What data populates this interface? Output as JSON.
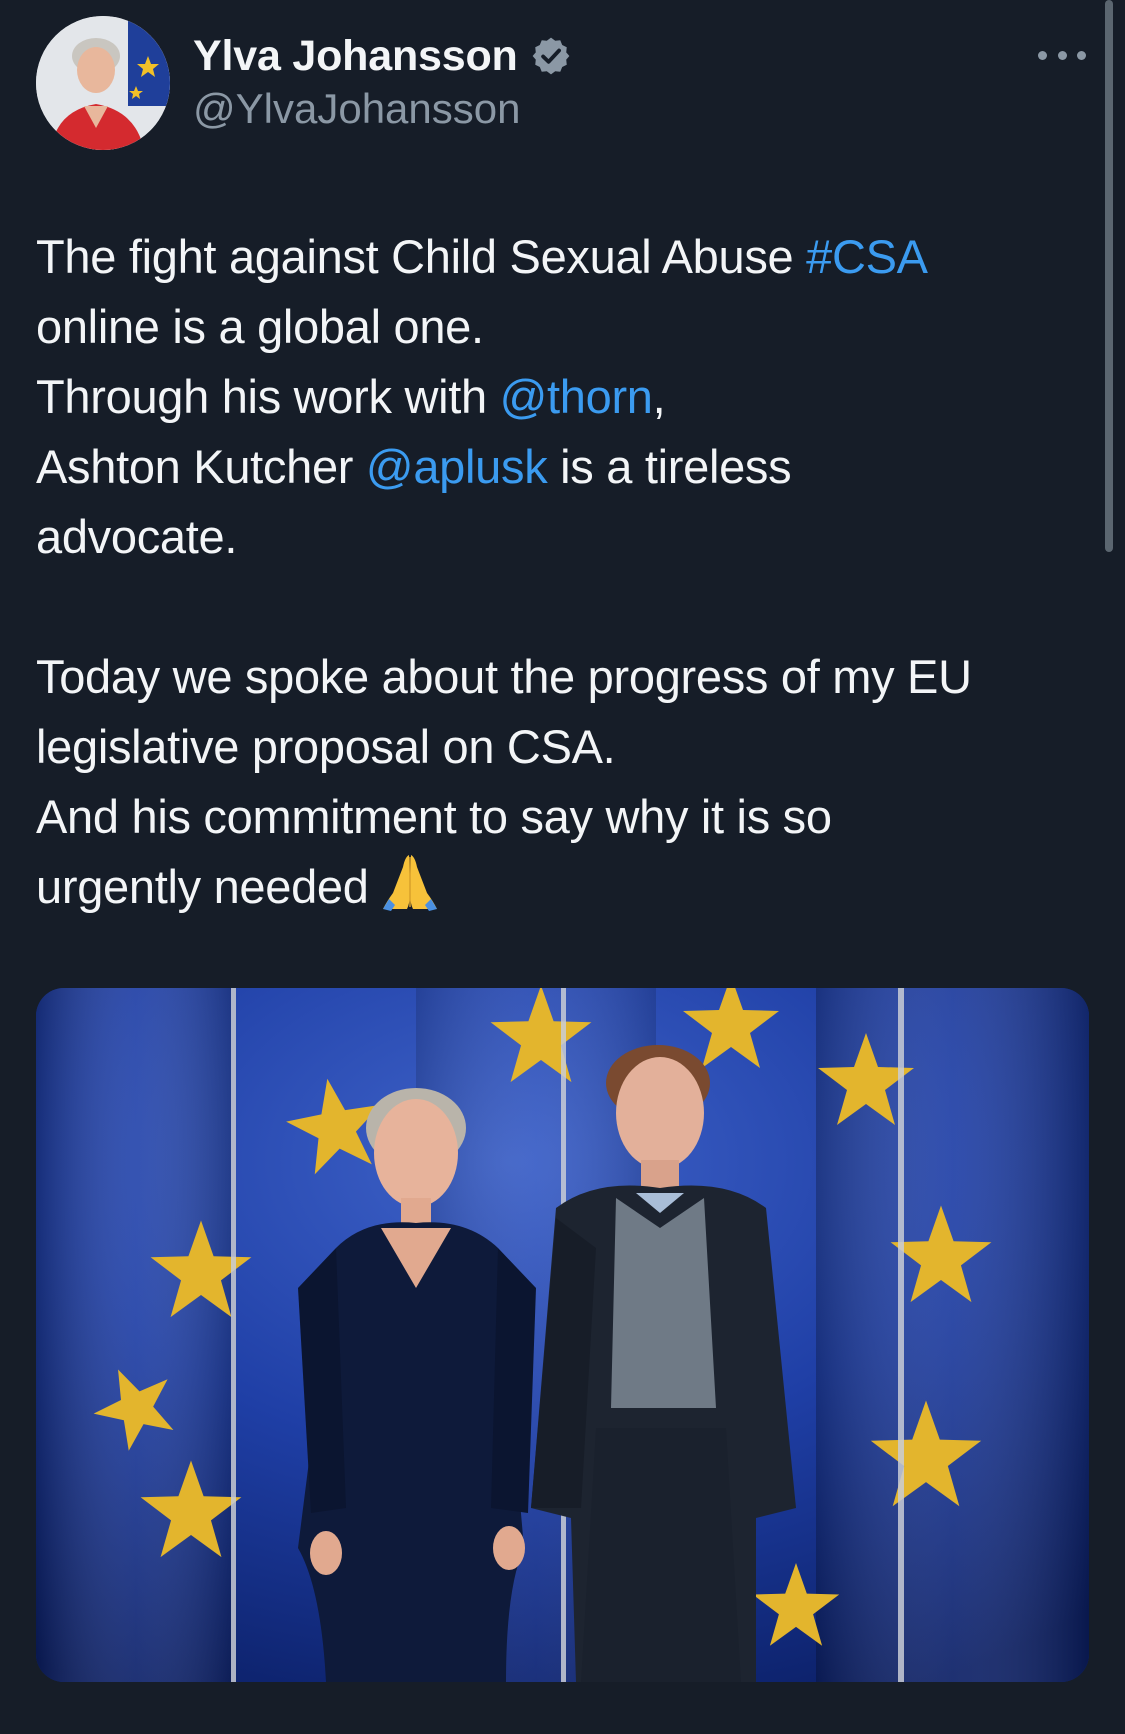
{
  "author": {
    "display_name": "Ylva Johansson",
    "handle": "@YlvaJohansson",
    "verified": true,
    "avatar_icon": "profile-photo"
  },
  "more_icon": "more-options-icon",
  "tweet": {
    "line1_text": "The fight against Child Sexual Abuse ",
    "line1_hashtag": "#CSA",
    "line2_text": "online is a global one.",
    "line3_text": "Through his work with ",
    "line3_mention": "@thorn",
    "line3_suffix": ",",
    "line4_text": "Ashton Kutcher ",
    "line4_mention": "@aplusk",
    "line4_suffix": " is a tireless",
    "line5_text": "advocate.",
    "line6_text": "Today we spoke about the progress of my EU",
    "line7_text": "legislative proposal on CSA.",
    "line8_text": "And his commitment to say why it is so",
    "line9_text": "urgently needed",
    "emoji": "folded-hands"
  },
  "colors": {
    "background": "#161d28",
    "text": "#f3f5f7",
    "secondary": "#8b98a5",
    "link": "#3b9bf0",
    "verified": "#8b98a5"
  },
  "media": {
    "type": "photo",
    "subject": "two people standing in front of an EU flag backdrop"
  }
}
